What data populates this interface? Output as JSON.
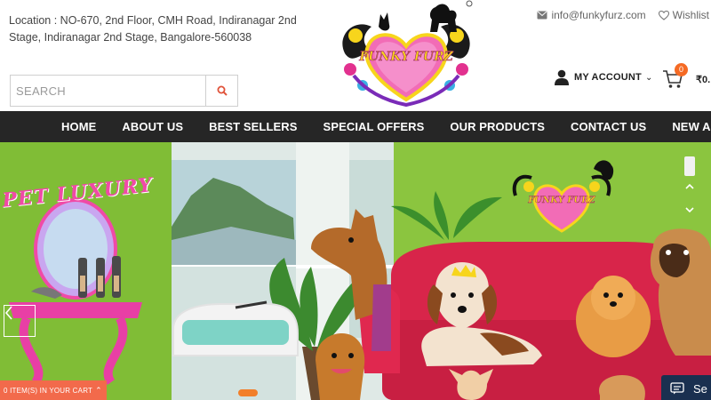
{
  "header": {
    "location": "Location : NO-670, 2nd Floor, CMH Road, Indiranagar 2nd Stage, Indiranagar 2nd Stage, Bangalore-560038",
    "email": "info@funkyfurz.com",
    "wishlist": "Wishlist",
    "logo_text": "FUNKY FURZ",
    "account_label": "MY ACCOUNT",
    "cart_count": "0",
    "cart_amount": "₹0."
  },
  "search": {
    "placeholder": "SEARCH"
  },
  "nav": {
    "items": [
      "HOME",
      "ABOUT US",
      "BEST SELLERS",
      "SPECIAL OFFERS",
      "OUR PRODUCTS",
      "CONTACT US",
      "NEW ARRIVALS"
    ]
  },
  "banner": {
    "headline": "PET LUXURY",
    "logo_text": "FUNKY FURZ"
  },
  "footer": {
    "cart_bar": "0 ITEM(S) IN YOUR CART",
    "chat_label": "Se"
  },
  "colors": {
    "nav_bg": "#262626",
    "accent": "#f56a24",
    "pink": "#f04aa7",
    "wall": "#8ac43a"
  }
}
